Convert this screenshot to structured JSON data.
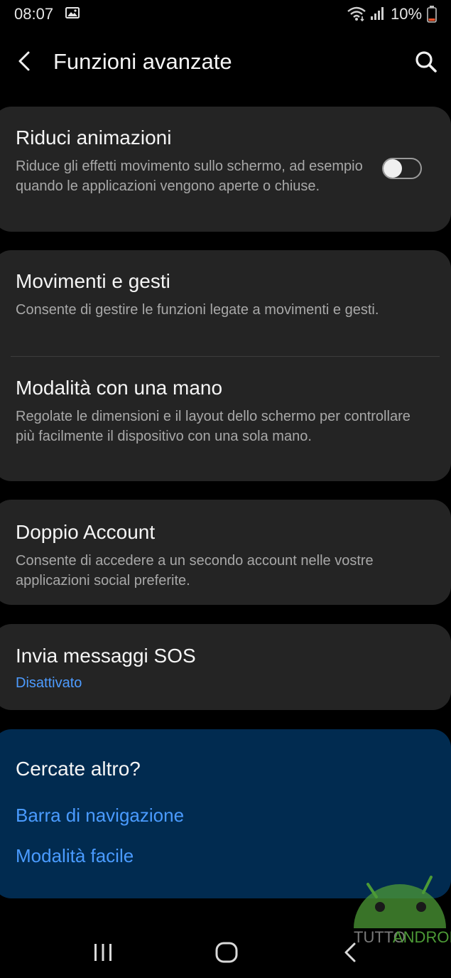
{
  "status_bar": {
    "time": "08:07",
    "battery_percent": "10%",
    "icons": [
      "gallery-icon",
      "wifi-icon",
      "signal-icon",
      "battery-icon"
    ]
  },
  "app_bar": {
    "title": "Funzioni avanzate",
    "back_icon": "chevron-left-icon",
    "search_icon": "search-icon"
  },
  "settings": {
    "reduce_animations": {
      "title": "Riduci animazioni",
      "description": "Riduce gli effetti movimento sullo schermo, ad esempio quando le applicazioni vengono aperte o chiuse.",
      "toggle_on": false
    },
    "motions_gestures": {
      "title": "Movimenti e gesti",
      "description": "Consente di gestire le funzioni legate a movimenti e gesti."
    },
    "one_hand_mode": {
      "title": "Modalità con una mano",
      "description": "Regolate le dimensioni e il layout dello schermo per controllare più facilmente il dispositivo con una sola mano."
    },
    "dual_account": {
      "title": "Doppio Account",
      "description": "Consente di accedere a un secondo account nelle vostre applicazioni social preferite."
    },
    "sos_messages": {
      "title": "Invia messaggi SOS",
      "status": "Disattivato"
    }
  },
  "looking_for_more": {
    "title": "Cercate altro?",
    "links": [
      "Barra di navigazione",
      "Modalità facile"
    ]
  },
  "watermark": {
    "text_part1": "TUTTO",
    "text_part2": "ANDROID"
  },
  "nav_bar": {
    "icons": [
      "recents-icon",
      "home-icon",
      "back-icon"
    ]
  },
  "colors": {
    "background": "#000000",
    "card": "#242424",
    "more_card": "#012b50",
    "accent": "#4a9bff",
    "secondary_text": "#a8a8a8"
  }
}
